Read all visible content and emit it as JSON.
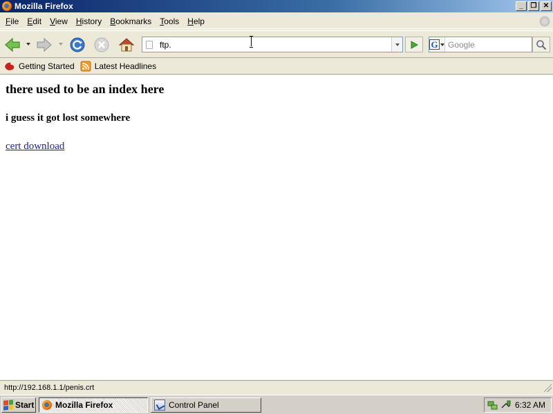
{
  "window": {
    "title": "Mozilla Firefox"
  },
  "menu": {
    "items": [
      "File",
      "Edit",
      "View",
      "History",
      "Bookmarks",
      "Tools",
      "Help"
    ]
  },
  "navigation": {
    "url_value": "ftp.",
    "search_placeholder": "Google",
    "icons": {
      "back": "back-arrow-icon",
      "forward": "forward-arrow-icon",
      "reload": "reload-icon",
      "stop": "stop-icon",
      "home": "home-icon",
      "go": "go-arrow-icon",
      "search": "magnifier-icon",
      "engine": "google-g-icon"
    }
  },
  "bookmarks": {
    "items": [
      {
        "label": "Getting Started",
        "icon": "firefox-icon"
      },
      {
        "label": "Latest Headlines",
        "icon": "rss-icon"
      }
    ]
  },
  "content": {
    "heading": "there used to be an index here",
    "subheading": "i guess it got lost somewhere",
    "link_text": "cert download"
  },
  "status": {
    "text": "http://192.168.1.1/penis.crt"
  },
  "taskbar": {
    "start_label": "Start",
    "tasks": [
      {
        "label": "Mozilla Firefox",
        "active": true
      },
      {
        "label": "Control Panel",
        "active": false
      }
    ],
    "clock": "6:32 AM"
  },
  "colors": {
    "titlebar_start": "#0a246a",
    "titlebar_end": "#a6caf0",
    "link": "#1a1aa6",
    "chrome": "#ece9d8",
    "taskbar": "#d4d0c8"
  }
}
